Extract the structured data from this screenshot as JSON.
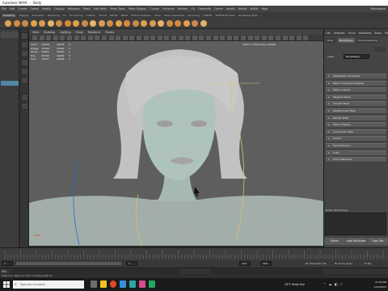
{
  "window": {
    "app": "Autodesk MAYA",
    "doc": "Body"
  },
  "menu": [
    "File",
    "Edit",
    "Create",
    "Select",
    "Modify",
    "Display",
    "Windows",
    "Mesh",
    "Edit Mesh",
    "Mesh Tools",
    "Mesh Display",
    "Curves",
    "Surfaces",
    "Deform",
    "UV",
    "Generate",
    "Cache",
    "Arnold",
    "Bifrost",
    "MASH",
    "Help"
  ],
  "workspace_label": "Workspace",
  "shelf_tabs": [
    "Sculpting",
    "Rigging",
    "Animation",
    "Rendering",
    "FX",
    "FX Caching",
    "Custom",
    "Arnold",
    "Bifrost",
    "MASH",
    "Motion Graphics",
    "XGen",
    "XGen Interactive",
    "Grooming",
    "TURTLE",
    "TURTLE Modules",
    "Rendering Tools",
    "..."
  ],
  "shelf_active": "Sculpting",
  "viewport_menu": [
    "View",
    "Shading",
    "Lighting",
    "Show",
    "Renderer",
    "Panels"
  ],
  "hud": {
    "rows": [
      {
        "label": "Verts:",
        "a": "25209",
        "b": "16934",
        "c": "0"
      },
      {
        "label": "Edges:",
        "a": "75104",
        "b": "32624",
        "c": "0"
      },
      {
        "label": "Faces:",
        "a": "49851",
        "b": "16640",
        "c": "0"
      },
      {
        "label": "Tris:",
        "a": "99702",
        "b": "33280",
        "c": "0"
      },
      {
        "label": "UVs:",
        "a": "29037",
        "b": "25806",
        "c": "0"
      }
    ]
  },
  "camera_label": "ACES 1.0 SDR-video (sRGB)",
  "attribute_editor": {
    "tabs": [
      "List",
      "Selected",
      "Focus",
      "Attributes",
      "Show",
      "Help"
    ],
    "subtabs": [
      "Body",
      "BodyShape",
      "BodyShapeOrig"
    ],
    "active_subtab": "BodyShape",
    "field_label": "mesh:",
    "field_value": "BodyShape",
    "sections": [
      "Tessellation Attributes",
      "Mesh Component Display",
      "Mesh Controls",
      "Tangent Space",
      "Smooth Mesh",
      "Displacement Map",
      "Render Stats",
      "Object Display",
      "Component Tags",
      "Arnold",
      "Node Behavior",
      "UUID",
      "Extra Attributes"
    ],
    "notes_label": "Notes: BodyShape",
    "buttons": [
      "Select",
      "Load Attributes",
      "Copy Tab"
    ]
  },
  "range": {
    "start": "1",
    "in": "1",
    "out": "120",
    "end": "200",
    "fps": "No Character Set",
    "layer": "No Anim Layer",
    "fps_rate": "24 fps"
  },
  "mel": {
    "label": "MEL"
  },
  "help_line": "Select an object to start sculpting with FX",
  "taskbar": {
    "search": "Type here to search",
    "weather": "19°C Partly fine",
    "time": "12:00 PM",
    "date": "1/01/2023"
  },
  "colors": {
    "accent": "#5285a6",
    "wire": "#39f0b4",
    "mesh": "#b9b9b9",
    "bg": "#5e5e5e"
  }
}
